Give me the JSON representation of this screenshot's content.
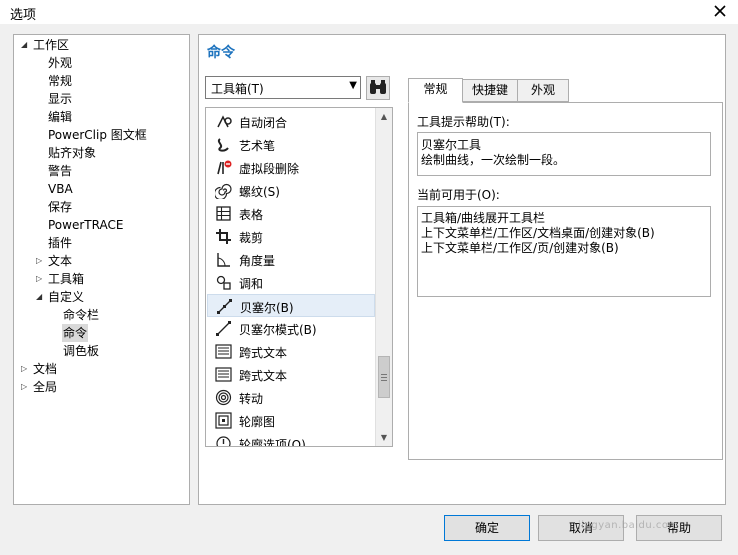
{
  "window": {
    "title": "选项"
  },
  "tree": [
    {
      "label": "工作区",
      "expander": "open"
    },
    {
      "label": "外观"
    },
    {
      "label": "常规"
    },
    {
      "label": "显示"
    },
    {
      "label": "编辑"
    },
    {
      "label": "PowerClip 图文框"
    },
    {
      "label": "贴齐对象"
    },
    {
      "label": "警告"
    },
    {
      "label": "VBA"
    },
    {
      "label": "保存"
    },
    {
      "label": "PowerTRACE"
    },
    {
      "label": "插件"
    },
    {
      "label": "文本",
      "expander": "closed"
    },
    {
      "label": "工具箱",
      "expander": "closed"
    },
    {
      "label": "自定义",
      "expander": "open"
    },
    {
      "label": "命令栏"
    },
    {
      "label": "命令",
      "selected": true
    },
    {
      "label": "调色板"
    },
    {
      "label": "文档",
      "expander": "closed"
    },
    {
      "label": "全局",
      "expander": "closed"
    }
  ],
  "main": {
    "section_title": "命令",
    "category_dropdown": {
      "value": "工具箱(T)"
    },
    "commands": [
      {
        "label": "自动闭合",
        "icon": "auto-close-icon"
      },
      {
        "label": "艺术笔",
        "icon": "artistic-media-icon"
      },
      {
        "label": "虚拟段删除",
        "icon": "virtual-segment-delete-icon"
      },
      {
        "label": "螺纹(S)",
        "icon": "spiral-icon"
      },
      {
        "label": "表格",
        "icon": "table-icon"
      },
      {
        "label": "裁剪",
        "icon": "crop-icon"
      },
      {
        "label": "角度量",
        "icon": "angular-dimension-icon"
      },
      {
        "label": "调和",
        "icon": "blend-icon"
      },
      {
        "label": "贝塞尔(B)",
        "icon": "bezier-icon",
        "selected": true
      },
      {
        "label": "贝塞尔模式(B)",
        "icon": "bezier-mode-icon"
      },
      {
        "label": "跨式文本",
        "icon": "span-text-icon"
      },
      {
        "label": "跨式文本",
        "icon": "span-text-icon"
      },
      {
        "label": "转动",
        "icon": "twirl-icon"
      },
      {
        "label": "轮廓图",
        "icon": "contour-icon"
      },
      {
        "label": "轮廓选项(O)",
        "icon": "outline-options-icon"
      }
    ],
    "tabs": [
      {
        "label": "常规",
        "active": true
      },
      {
        "label": "快捷键"
      },
      {
        "label": "外观"
      }
    ],
    "tooltip_help": {
      "label": "工具提示帮助(T):",
      "lines": [
        "贝塞尔工具",
        "绘制曲线，一次绘制一段。"
      ]
    },
    "available_in": {
      "label": "当前可用于(O):",
      "lines": [
        "工具箱/曲线展开工具栏",
        "上下文菜单栏/工作区/文档桌面/创建对象(B)",
        "上下文菜单栏/工作区/页/创建对象(B)"
      ]
    }
  },
  "buttons": {
    "ok": "确定",
    "cancel": "取消",
    "help": "帮助"
  },
  "watermark": "jingyan.baidu.com"
}
